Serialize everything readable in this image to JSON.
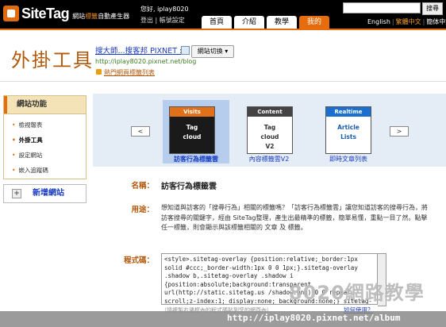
{
  "header": {
    "logo_text": "SiteTag",
    "logo_sub_pre": "網站",
    "logo_sub_hl": "標籤",
    "logo_sub_post": "自動產生器",
    "greeting": "您好, iplay8020",
    "links": "登出 | 帳號設定",
    "search_placeholder": "",
    "search_label": "搜尋",
    "lang_en": "English",
    "lang_tw": "繁體中文",
    "lang_cn": "簡体中文",
    "nav": [
      {
        "label": "首頁",
        "active": false
      },
      {
        "label": "介紹",
        "active": false
      },
      {
        "label": "教學",
        "active": false
      },
      {
        "label": "我的",
        "active": true
      }
    ]
  },
  "title_area": {
    "page_title": "外掛工具",
    "blog_name": "搜大師...搜客邦 PIXNET ::",
    "switch_label": "網站切換 ▾",
    "blog_url": "http://iplay8020.pixnet.net/blog",
    "fav_link": "熱門網頁標籤列表"
  },
  "sidebar": {
    "heading": "網站功能",
    "items": [
      {
        "label": "檢視報表",
        "current": false
      },
      {
        "label": "外掛工具",
        "current": true
      },
      {
        "label": "設定網站",
        "current": false
      },
      {
        "label": "嵌入追蹤碼",
        "current": false
      }
    ],
    "add_site": "新增網站"
  },
  "carousel": {
    "prev": "<",
    "next": ">",
    "cards": [
      {
        "bar": "Visits",
        "body": "Tag\ncloud",
        "caption": "訪客行為標籤雲",
        "bar_color": "#e0701a",
        "body_bg": "#1a1a1a",
        "body_color": "#ffffff",
        "selected": true
      },
      {
        "bar": "Content",
        "body": "Tag\ncloud\nV2",
        "caption": "內容標籤雲V2",
        "bar_color": "#444444",
        "body_bg": "#ffffff",
        "body_color": "#333333",
        "selected": false
      },
      {
        "bar": "Realtime",
        "body": "Article\nLists",
        "caption": "即時文章列表",
        "bar_color": "#1a6fd0",
        "body_bg": "#ffffff",
        "body_color": "#1a5cb0",
        "selected": false
      }
    ]
  },
  "detail": {
    "name_label": "名稱：",
    "name_value": "訪客行為標籤雲",
    "usage_label": "用途：",
    "usage_text": "想知道與訪客的「搜尋行為」相關的標籤嗎？「訪客行為標籤雲」讓您知道訪客的搜尋行為，將訪客搜尋的關鍵字，經由 SiteTag整理，產生出最精準的標籤，簡單易懂，重點一目了然。點擊任一標籤，則會顯示與該標籤相關的 文章 及 標籤。",
    "code_label": "程式碼：",
    "code_text": "<style>.sitetag-overlay {position:relative;_border:1px solid #ccc;_border-width:1px 0 0 1px;}.sitetag-overlay .shadow b,.sitetag-overlay .shadow i {position:absolute;background:transparent url(http://static.sitetag.us /shadow.png) 0 0 repeat scroll;z-index:1;_display:none;_background:none;} sitetag-overlay .shadow {_display:none;}.sitetag-overlay .shadow b+i",
    "code_hint": "（請複製右邊框內的程式碼貼到您的網頁內）",
    "code_link": "如何使用？"
  },
  "watermark": {
    "big": "8020網路教學",
    "url": "http://iplay8020.pixnet.net/album"
  }
}
